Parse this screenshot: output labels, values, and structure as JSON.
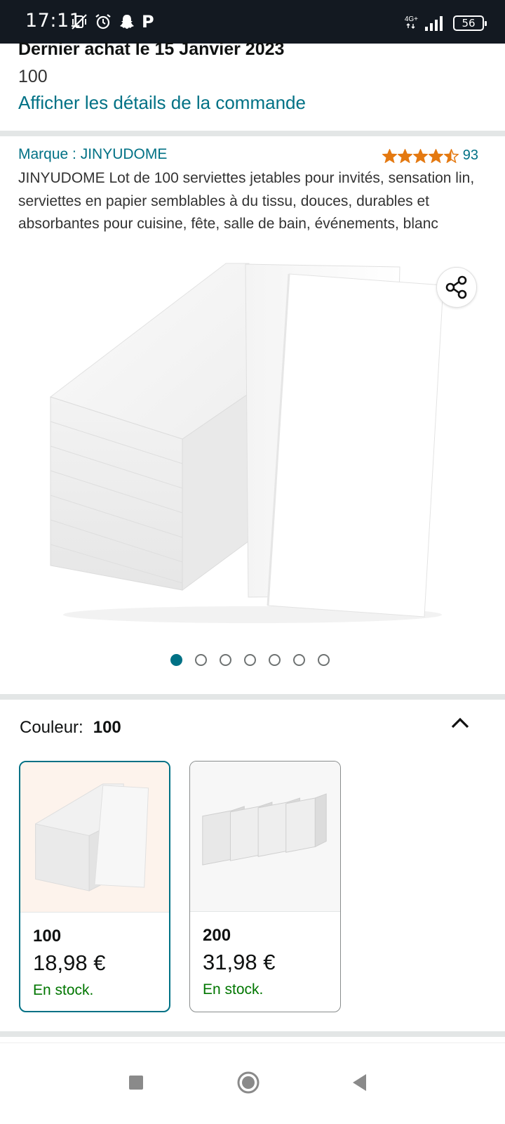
{
  "status_bar": {
    "time": "17:11",
    "letter": "P",
    "network": "4G+",
    "battery": "56"
  },
  "order": {
    "date_line": "Dernier achat le 15 Janvier 2023",
    "quantity": "100",
    "details_link": "Afficher les détails de la commande"
  },
  "product": {
    "brand": "Marque : JINYUDOME",
    "rating_stars": 4.5,
    "rating_count": "93",
    "title": "JINYUDOME Lot de 100 serviettes jetables pour invités, sensation lin, serviettes en papier semblables à du tissu, douces, durables et absorbantes pour cuisine, fête, salle de bain, événements, blanc",
    "image_count": 7,
    "active_image": 1
  },
  "variant": {
    "label": "Couleur:",
    "selected": "100",
    "options": [
      {
        "name": "100",
        "price": "18,98 €",
        "stock": "En stock."
      },
      {
        "name": "200",
        "price": "31,98 €",
        "stock": "En stock."
      }
    ]
  },
  "colors": {
    "link": "#007185",
    "star": "#e47911",
    "in_stock": "#007600",
    "status_bar": "#131921"
  }
}
